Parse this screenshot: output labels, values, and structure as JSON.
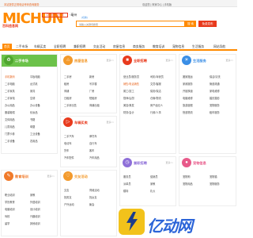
{
  "topbar": {
    "notice": "本站提供正规电话号码查询服务",
    "links": "欢迎您 | 商家中心 | 手机版"
  },
  "header": {
    "logo_text": "MICHUN",
    "logo_badge": "中国领先的分类",
    "slogan": "百科信息网",
    "city": "·亳州",
    "city_switch": "[切换]",
    "search_placeholder": "请输入关键词搜索",
    "search_button": "搜 索",
    "post_button": "免费发布"
  },
  "nav": [
    {
      "label": "首页",
      "active": true
    },
    {
      "label": "二手市场",
      "active": false
    },
    {
      "label": "车辆买卖",
      "active": false
    },
    {
      "label": "全职招聘",
      "active": false
    },
    {
      "label": "兼职招聘",
      "active": false
    },
    {
      "label": "交友活动",
      "active": false
    },
    {
      "label": "房屋信息",
      "active": false
    },
    {
      "label": "商务服务",
      "active": false
    },
    {
      "label": "教育培训",
      "active": false
    },
    {
      "label": "宠物信息",
      "active": false
    },
    {
      "label": "生活服务",
      "active": false
    },
    {
      "label": "网站导航",
      "active": false
    }
  ],
  "panels": {
    "secondhand": {
      "title": "二手市场",
      "more": "更多>>",
      "items": [
        "手机数码",
        "平板电脑",
        "二手电脑",
        "台式机",
        "二手家具",
        "家具",
        "二手家电",
        "空调",
        "办公用品",
        "办公设备",
        "服装鞋帽",
        "化妆品",
        "文体用品",
        "书籍",
        "儿童用品",
        "母婴",
        "门票卡券",
        "工业设备",
        "二手设备",
        "农用品"
      ]
    },
    "house": {
      "title": "房屋信息",
      "more": "更多>>",
      "items": [
        "二手房",
        "新房",
        "租房",
        "写字楼",
        "商铺",
        "厂房",
        "日租房",
        "短租房",
        "二手房出售",
        "商铺出租",
        "写字楼出售",
        "厂房仓库"
      ]
    },
    "fulltime": {
      "title": "全职招聘",
      "more": "更多>>",
      "items": [
        "营业员/服务员",
        "司机/驾驶员",
        "销售/电话销售",
        "文员/客服",
        "普工/技工",
        "保安/保洁",
        "厨师/后厨",
        "仓管/物流",
        "美容/美发",
        "房产经纪人",
        "财务/会计",
        "行政/人事"
      ]
    },
    "life": {
      "title": "生活服务",
      "more": "更多>>",
      "items": [
        "搬家搬运",
        "保洁/清洗",
        "家政服务",
        "管道疏通",
        "开锁换锁",
        "家电维修",
        "电脑维修",
        "婚庆摄影",
        "旅游度假",
        "宠物服务",
        "快递物流",
        "租车服务"
      ]
    },
    "vehicles": {
      "title": "车辆买卖",
      "more": "更多>>",
      "items": [
        "二手汽车",
        "摩托车",
        "电动车",
        "自行车",
        "货车",
        "客车",
        "汽车配件",
        "汽车用品",
        "汽车服务",
        "汽车保险"
      ]
    },
    "parttime": {
      "title": "兼职招聘",
      "more": "更多>>",
      "items": [
        "服务员",
        "促销员",
        "派单员",
        "家教",
        "模特",
        "礼仪",
        "校园代理",
        "设计",
        "翻译",
        "其他兼职"
      ]
    },
    "education": {
      "title": "教育培训",
      "more": "更多>>",
      "items": [
        "职业培训",
        "家教",
        "学历教育",
        "外语培训",
        "电脑培训",
        "设计培训",
        "驾校",
        "兴趣培训",
        "留学",
        "其他培训"
      ]
    },
    "dating": {
      "title": "交友活动",
      "more": "更多>>",
      "items": [
        "交友",
        "同城活动",
        "找男友",
        "找女友",
        "户外运动",
        "聚会"
      ]
    },
    "pets": {
      "title": "宠物信息",
      "more": "更多>>",
      "items": [
        "宠物狗",
        "宠物猫",
        "宠物用品",
        "宠物服务",
        "宠物领养",
        "其他宠物"
      ]
    },
    "business": {
      "title": "商务服务",
      "more": "更多>>",
      "items": [
        "装修",
        "公司注册",
        "广告",
        "印刷",
        "设计",
        "网站建设",
        "法律",
        "会计"
      ]
    }
  },
  "watermark": {
    "text": "亿动网",
    "brand_color": "#2b64d8"
  },
  "colors": {
    "accent": "#ff8a00",
    "red": "#e83a1d",
    "green": "#6cc24a",
    "purple": "#8e6fd8",
    "blue": "#3a8ee6",
    "orange": "#f39a2c",
    "pink": "#e85a8a"
  }
}
